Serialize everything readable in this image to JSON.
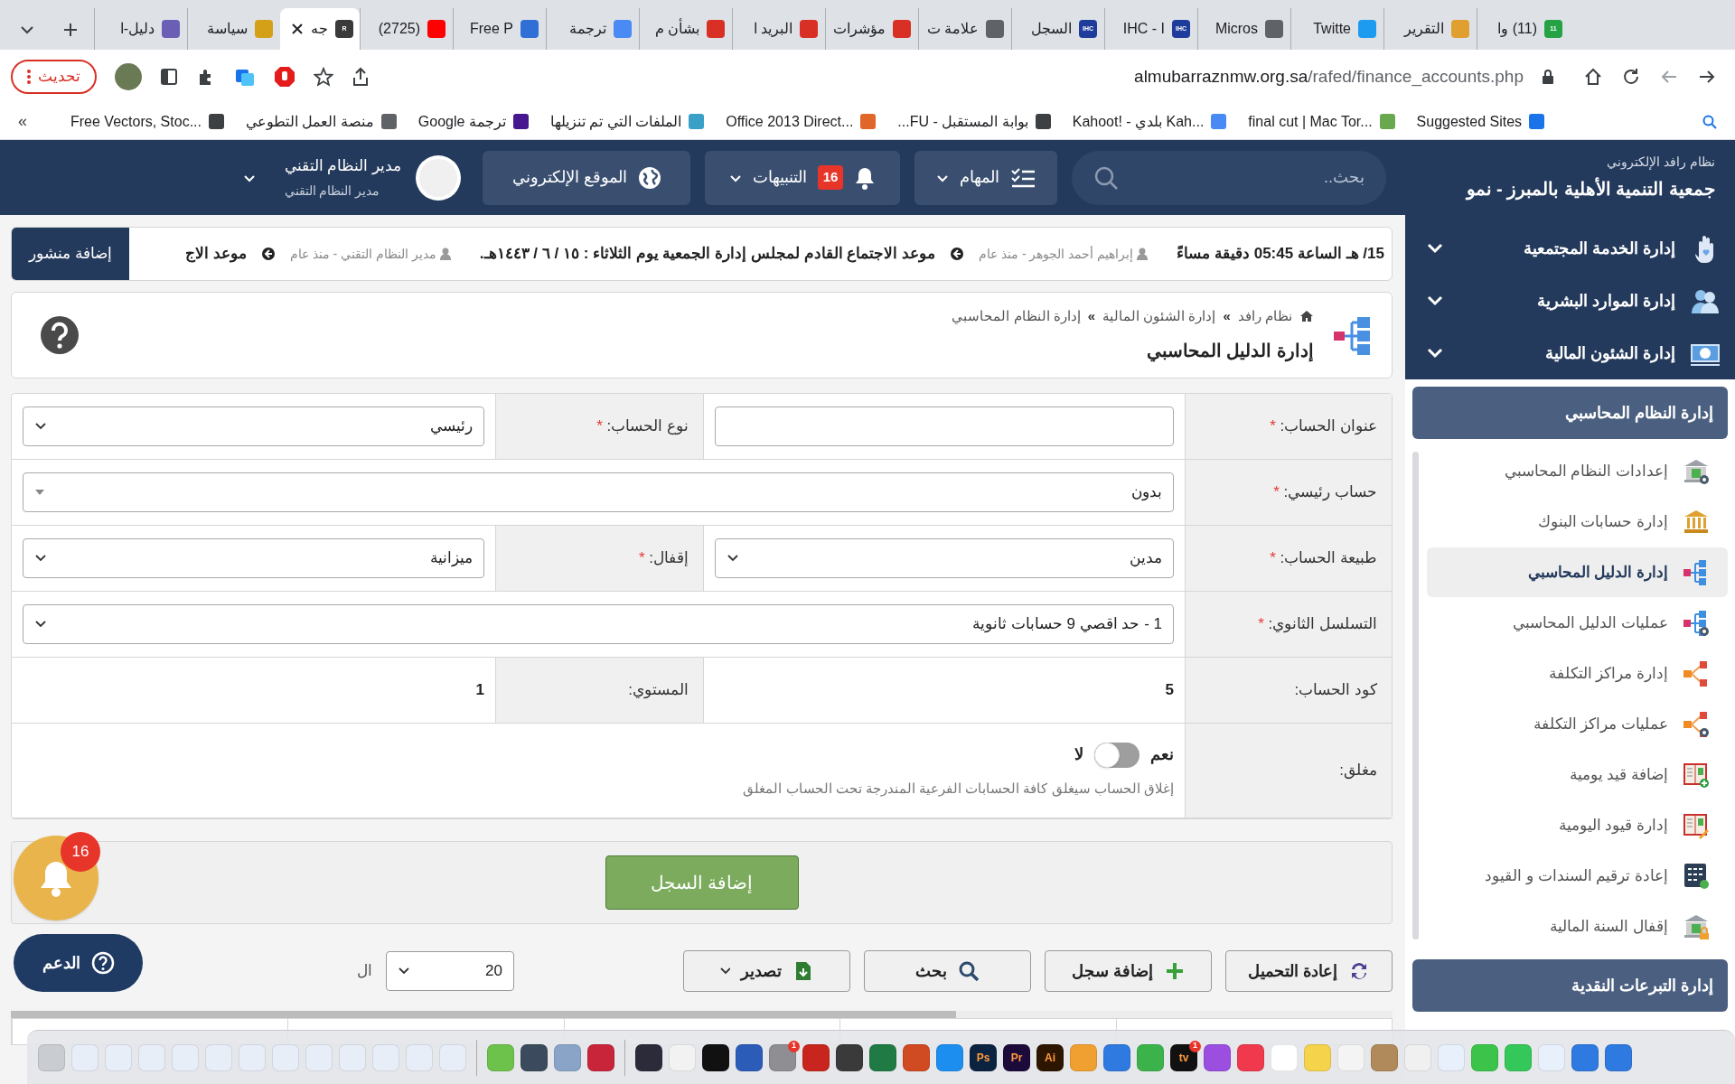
{
  "browser": {
    "tabs": [
      {
        "title": "(11) وا",
        "selected": false,
        "color": "#25a244",
        "icon_text": "11"
      },
      {
        "title": "التقرير",
        "selected": false,
        "color": "#e0a030"
      },
      {
        "title": "Twitte",
        "selected": false,
        "color": "#1d9bf0"
      },
      {
        "title": "Micros",
        "selected": false,
        "color": "#5f6368"
      },
      {
        "title": "IHC - I",
        "selected": false,
        "color": "#1e3c9c",
        "icon_text": "IHC"
      },
      {
        "title": "السجل",
        "selected": false,
        "color": "#1e3c9c",
        "icon_text": "IHC"
      },
      {
        "title": "علامة ت",
        "selected": false,
        "color": "#5f6368"
      },
      {
        "title": "مؤشرات",
        "selected": false,
        "color": "#d93025"
      },
      {
        "title": "البريد ا",
        "selected": false,
        "color": "#d93025"
      },
      {
        "title": "بشأن م",
        "selected": false,
        "color": "#d93025"
      },
      {
        "title": "ترجمة",
        "selected": false,
        "color": "#4a8af4"
      },
      {
        "title": "Free P",
        "selected": false,
        "color": "#2f6fd6"
      },
      {
        "title": "(2725)",
        "selected": false,
        "color": "#ff0000"
      },
      {
        "title": "جه",
        "selected": true,
        "color": "#3a3a3a",
        "icon_text": "R"
      },
      {
        "title": "سياسة",
        "selected": false,
        "color": "#d4a017"
      },
      {
        "title": "دليل-ا",
        "selected": false,
        "color": "#6b5fb5"
      }
    ],
    "update_button": "تحديث",
    "address": {
      "domain": "almubarraznmw.org.sa",
      "path": "/rafed/finance_accounts.php"
    },
    "bookmarks_more": "«",
    "bookmarks": [
      "Suggested Sites",
      "final cut | Mac Tor...",
      "Kahoot! - بلدي Kah...",
      "بوابة المستقبل - FU...",
      "Office 2013 Direct...",
      "الملفات التي تم تنزيلها",
      "ترجمة Google",
      "منصة العمل التطوعي",
      "Free Vectors, Stoc..."
    ]
  },
  "header": {
    "system_name": "نظام رافد الإلكتروني",
    "org_name": "جمعية التنمية الأهلية بالمبرز - نمو",
    "search": {
      "placeholder": "بحث.."
    },
    "tasks": "المهام",
    "notifications": {
      "label": "التنبيهات",
      "count": "16"
    },
    "website": "الموقع الإلكتروني",
    "user": {
      "name": "مدير النظام التقني",
      "role": "مدير النظام التقني"
    }
  },
  "ticker": {
    "items": [
      {
        "text": "15/ هـ الساعة 05:45 دقيقة مساءً",
        "meta": "إبراهيم أحمد الجوهر - منذ عام"
      },
      {
        "text": "موعد الاجتماع القادم لمجلس إدارة الجمعية يوم الثلاثاء : ١٥ / ٦ / ١٤٤٣هـ.",
        "meta": "مدير النظام التقني - منذ عام"
      },
      {
        "text": "موعد الاج"
      }
    ],
    "add_post": "إضافة منشور"
  },
  "page": {
    "breadcrumb": {
      "separator": "»",
      "items": [
        "نظام رافد",
        "إدارة الشئون المالية",
        "إدارة النظام المحاسبي"
      ]
    },
    "title": "إدارة الدليل المحاسبي"
  },
  "form": {
    "rows": [
      {
        "cells": [
          {
            "label": "عنوان الحساب:",
            "required_mark": "*",
            "field": {
              "kind": "text"
            }
          },
          {
            "label": "نوع الحساب:",
            "required_mark": "*",
            "field": {
              "kind": "select",
              "value": "رئيسي"
            }
          }
        ]
      },
      {
        "cells": [
          {
            "label": "حساب رئيسي:",
            "required_mark": "*",
            "field": {
              "kind": "combo",
              "value": "بدون"
            }
          }
        ]
      },
      {
        "cells": [
          {
            "label": "طبيعة الحساب:",
            "required_mark": "*",
            "field": {
              "kind": "select",
              "value": "مدين"
            }
          },
          {
            "label": "إقفال:",
            "required_mark": "*",
            "field": {
              "kind": "select",
              "value": "ميزانية"
            }
          }
        ]
      },
      {
        "cells": [
          {
            "label": "التسلسل الثانوي:",
            "required_mark": "*",
            "field": {
              "kind": "select",
              "value": "1 - حد اقصي 9 حسابات ثانوية"
            }
          }
        ]
      },
      {
        "cells": [
          {
            "label": "كود الحساب:",
            "field": {
              "kind": "static",
              "value": "5"
            }
          },
          {
            "label": "المستوي:",
            "field": {
              "kind": "static",
              "value": "1"
            }
          }
        ]
      },
      {
        "cells": [
          {
            "label": "مغلق:",
            "field": {
              "kind": "toggle",
              "on": false,
              "yes": "نعم",
              "no": "لا",
              "hint": "إغلاق الحساب سيغلق كافة الحسابات الفرعية المندرجة تحت الحساب المغلق"
            }
          }
        ]
      }
    ],
    "submit": "إضافة السجل"
  },
  "toolbar": {
    "buttons": [
      {
        "kind": "reload",
        "label": "إعادة التحميل"
      },
      {
        "kind": "add",
        "label": "إضافة سجل"
      },
      {
        "kind": "search",
        "label": "بحث"
      },
      {
        "kind": "export",
        "label": "تصدير"
      }
    ],
    "page_size": "20",
    "page_size_label": "ال"
  },
  "floating": {
    "bell_count": "16",
    "support": "الدعم"
  },
  "sidebar": {
    "groups": [
      {
        "label": "إدارة الخدمة المجتمعية",
        "expanded": false
      },
      {
        "label": "إدارة الموارد البشرية",
        "expanded": false
      },
      {
        "label": "إدارة الشئون المالية",
        "expanded": false
      }
    ],
    "section": "إدارة النظام المحاسبي",
    "items": [
      {
        "label": "إعدادات النظام المحاسبي",
        "selected": false
      },
      {
        "label": "إدارة حسابات البنوك",
        "selected": false
      },
      {
        "label": "إدارة الدليل المحاسبي",
        "selected": true
      },
      {
        "label": "عمليات الدليل المحاسبي",
        "selected": false
      },
      {
        "label": "إدارة مراكز التكلفة",
        "selected": false
      },
      {
        "label": "عمليات مراكز التكلفة",
        "selected": false
      },
      {
        "label": "إضافة قيد يومية",
        "selected": false
      },
      {
        "label": "إدارة قيود اليومية",
        "selected": false
      },
      {
        "label": "إعادة ترقيم السندات و القيود",
        "selected": false
      },
      {
        "label": "إقفال السنة المالية",
        "selected": false
      }
    ],
    "next_section": "إدارة التبرعات النقدية"
  },
  "dock": [
    {
      "color": "#2f7ae0"
    },
    {
      "color": "#2f7ae0"
    },
    {
      "color": "#e8f0fb"
    },
    {
      "color": "#34c759"
    },
    {
      "color": "#3cc44a"
    },
    {
      "color": "#e8f0fb"
    },
    {
      "color": "#f0f0f0"
    },
    {
      "color": "#b08a5a"
    },
    {
      "color": "#f4f4f4"
    },
    {
      "color": "#f5d34a"
    },
    {
      "color": "#ffffff"
    },
    {
      "color": "#f0394d"
    },
    {
      "color": "#9b4ee0"
    },
    {
      "color": "#111111",
      "label": "tv",
      "badge": "1"
    },
    {
      "color": "#3cb34a"
    },
    {
      "color": "#2f7ae0"
    },
    {
      "color": "#f0a030"
    },
    {
      "color": "#2d1600",
      "label": "Ai"
    },
    {
      "color": "#1c0a3a",
      "label": "Pr"
    },
    {
      "color": "#0b2240",
      "label": "Ps"
    },
    {
      "color": "#1c8ef0"
    },
    {
      "color": "#d04a22"
    },
    {
      "color": "#1f7a43"
    },
    {
      "color": "#3a3a3a"
    },
    {
      "color": "#c8251e"
    },
    {
      "color": "#8e8e93",
      "badge": "1"
    },
    {
      "color": "#2b5cb8"
    },
    {
      "color": "#111111"
    },
    {
      "color": "#f2f2f2"
    },
    {
      "color": "#2b2b3a"
    },
    {
      "color": "#c8253b"
    },
    {
      "color": "#8aa4c8"
    },
    {
      "color": "#3b4a5c"
    },
    {
      "color": "#6cc24a"
    },
    {
      "color": "#e8eef8"
    },
    {
      "color": "#e8eef8"
    },
    {
      "color": "#e8eef8"
    },
    {
      "color": "#e8eef8"
    },
    {
      "color": "#e8eef8"
    },
    {
      "color": "#e8eef8"
    },
    {
      "color": "#e8eef8"
    },
    {
      "color": "#e8eef8"
    },
    {
      "color": "#e8eef8"
    },
    {
      "color": "#e8eef8"
    },
    {
      "color": "#e8eef8"
    },
    {
      "color": "#e8eef8"
    },
    {
      "color": "#c9ccd1"
    }
  ]
}
